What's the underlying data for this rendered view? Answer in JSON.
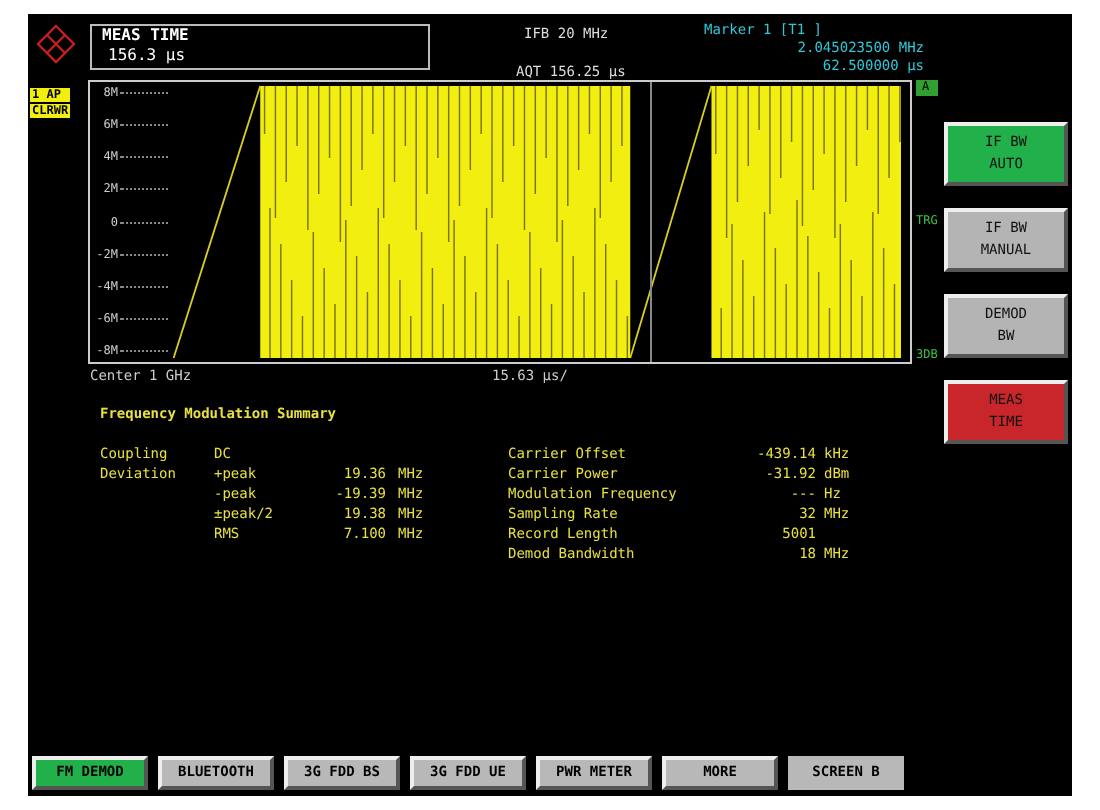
{
  "header": {
    "meas_box": {
      "title": "MEAS TIME",
      "value": "156.3 µs"
    },
    "ifb": "IFB 20 MHz",
    "aqt": "AQT 156.25 µs",
    "marker": {
      "title": "Marker 1 [T1 ]",
      "frequency": "2.045023500 MHz",
      "time": "62.500000 µs"
    }
  },
  "trace_labels": [
    "1 AP",
    "CLRWR"
  ],
  "y_axis_labels": [
    "8M",
    "6M",
    "4M",
    "2M",
    "0",
    "-2M",
    "-4M",
    "-6M",
    "-8M"
  ],
  "side_labels": [
    {
      "text": "A",
      "kind": "boxed"
    },
    {
      "text": "TRG",
      "kind": "plain"
    },
    {
      "text": "3DB",
      "kind": "plain"
    }
  ],
  "x_axis": {
    "left": "Center 1 GHz",
    "center": "15.63 µs/"
  },
  "summary": {
    "title": "Frequency Modulation Summary",
    "left_rows": [
      {
        "label": "Coupling",
        "name": "DC"
      },
      {
        "label": "Deviation",
        "name": "+peak",
        "value": "19.36",
        "unit": "MHz"
      },
      {
        "name": "-peak",
        "value": "-19.39",
        "unit": "MHz"
      },
      {
        "name": "±peak/2",
        "value": "19.38",
        "unit": "MHz"
      },
      {
        "name": "RMS",
        "value": "7.100",
        "unit": "MHz"
      }
    ],
    "right_rows": [
      {
        "label": "Carrier Offset",
        "value": "-439.14",
        "unit": "kHz"
      },
      {
        "label": "Carrier Power",
        "value": "-31.92",
        "unit": "dBm"
      },
      {
        "label": "Modulation Frequency",
        "value": "---",
        "unit": "Hz"
      },
      {
        "label": "Sampling Rate",
        "value": "32",
        "unit": "MHz"
      },
      {
        "label": "Record Length",
        "value": "5001"
      },
      {
        "label": "Demod Bandwidth",
        "value": "18",
        "unit": "MHz"
      }
    ]
  },
  "softkeys": [
    {
      "lines": [
        "IF BW",
        "AUTO"
      ],
      "color": "#22b04a"
    },
    {
      "lines": [
        "IF BW",
        "MANUAL"
      ],
      "color": "#b4b4b4"
    },
    {
      "lines": [
        "DEMOD",
        "BW"
      ],
      "color": "#b4b4b4"
    },
    {
      "lines": [
        "MEAS",
        "TIME"
      ],
      "color": "#c8262a"
    }
  ],
  "hotkeys": [
    {
      "label": "FM DEMOD",
      "selected": true
    },
    {
      "label": "BLUETOOTH",
      "selected": false
    },
    {
      "label": "3G FDD BS",
      "selected": false
    },
    {
      "label": "3G FDD UE",
      "selected": false
    },
    {
      "label": "PWR METER",
      "selected": false
    },
    {
      "label": "MORE",
      "selected": false
    },
    {
      "label": "SCREEN B",
      "selected": false,
      "kind": "flat"
    }
  ]
}
